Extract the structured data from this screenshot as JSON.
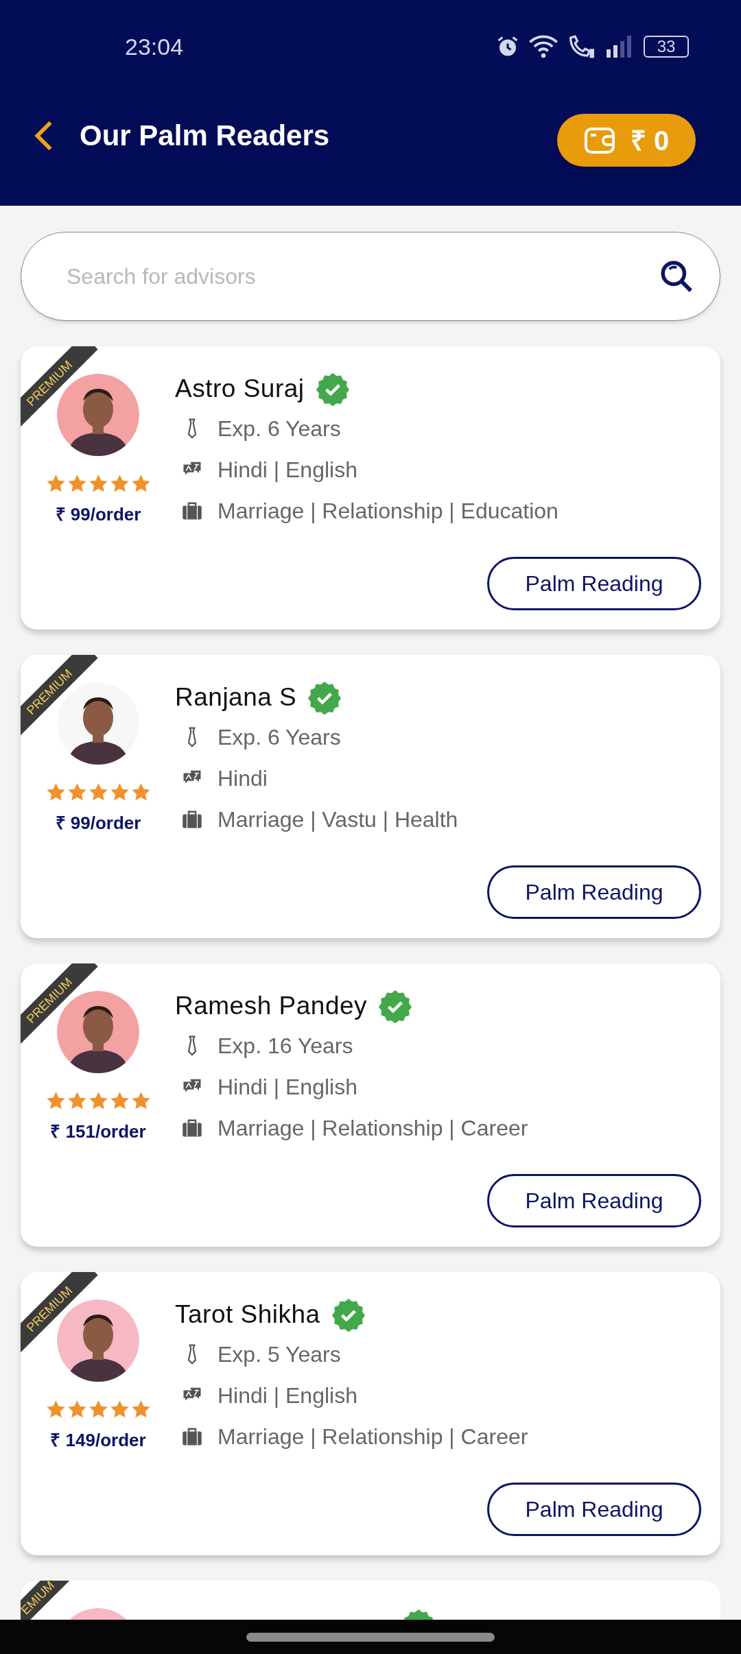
{
  "status_bar": {
    "time": "23:04",
    "battery": "33"
  },
  "header": {
    "title": "Our Palm Readers",
    "wallet": "₹ 0"
  },
  "search": {
    "placeholder": "Search for advisors"
  },
  "advisors": [
    {
      "kind": "full",
      "badge": "PREMIUM",
      "name": "Astro Suraj",
      "verified": true,
      "stars": 5,
      "price": "₹ 99/order",
      "experience": "Exp. 6 Years",
      "languages": "Hindi | English",
      "skills": "Marriage | Relationship | Education",
      "action": "Palm Reading"
    },
    {
      "kind": "full",
      "badge": "PREMIUM",
      "name": "Ranjana S",
      "verified": true,
      "stars": 5,
      "price": "₹ 99/order",
      "experience": "Exp. 6 Years",
      "languages": "Hindi",
      "skills": "Marriage | Vastu | Health",
      "action": "Palm Reading"
    },
    {
      "kind": "full",
      "badge": "PREMIUM",
      "name": "Ramesh Pandey",
      "verified": true,
      "stars": 5,
      "price": "₹ 151/order",
      "experience": "Exp. 16 Years",
      "languages": "Hindi | English",
      "skills": "Marriage | Relationship | Career",
      "action": "Palm Reading"
    },
    {
      "kind": "full",
      "badge": "PREMIUM",
      "name": "Tarot Shikha",
      "verified": true,
      "stars": 5,
      "price": "₹ 149/order",
      "experience": "Exp. 5 Years",
      "languages": "Hindi | English",
      "skills": "Marriage | Relationship | Career",
      "action": "Palm Reading"
    },
    {
      "kind": "cut",
      "badge": "EMIUM",
      "verified": true
    }
  ]
}
